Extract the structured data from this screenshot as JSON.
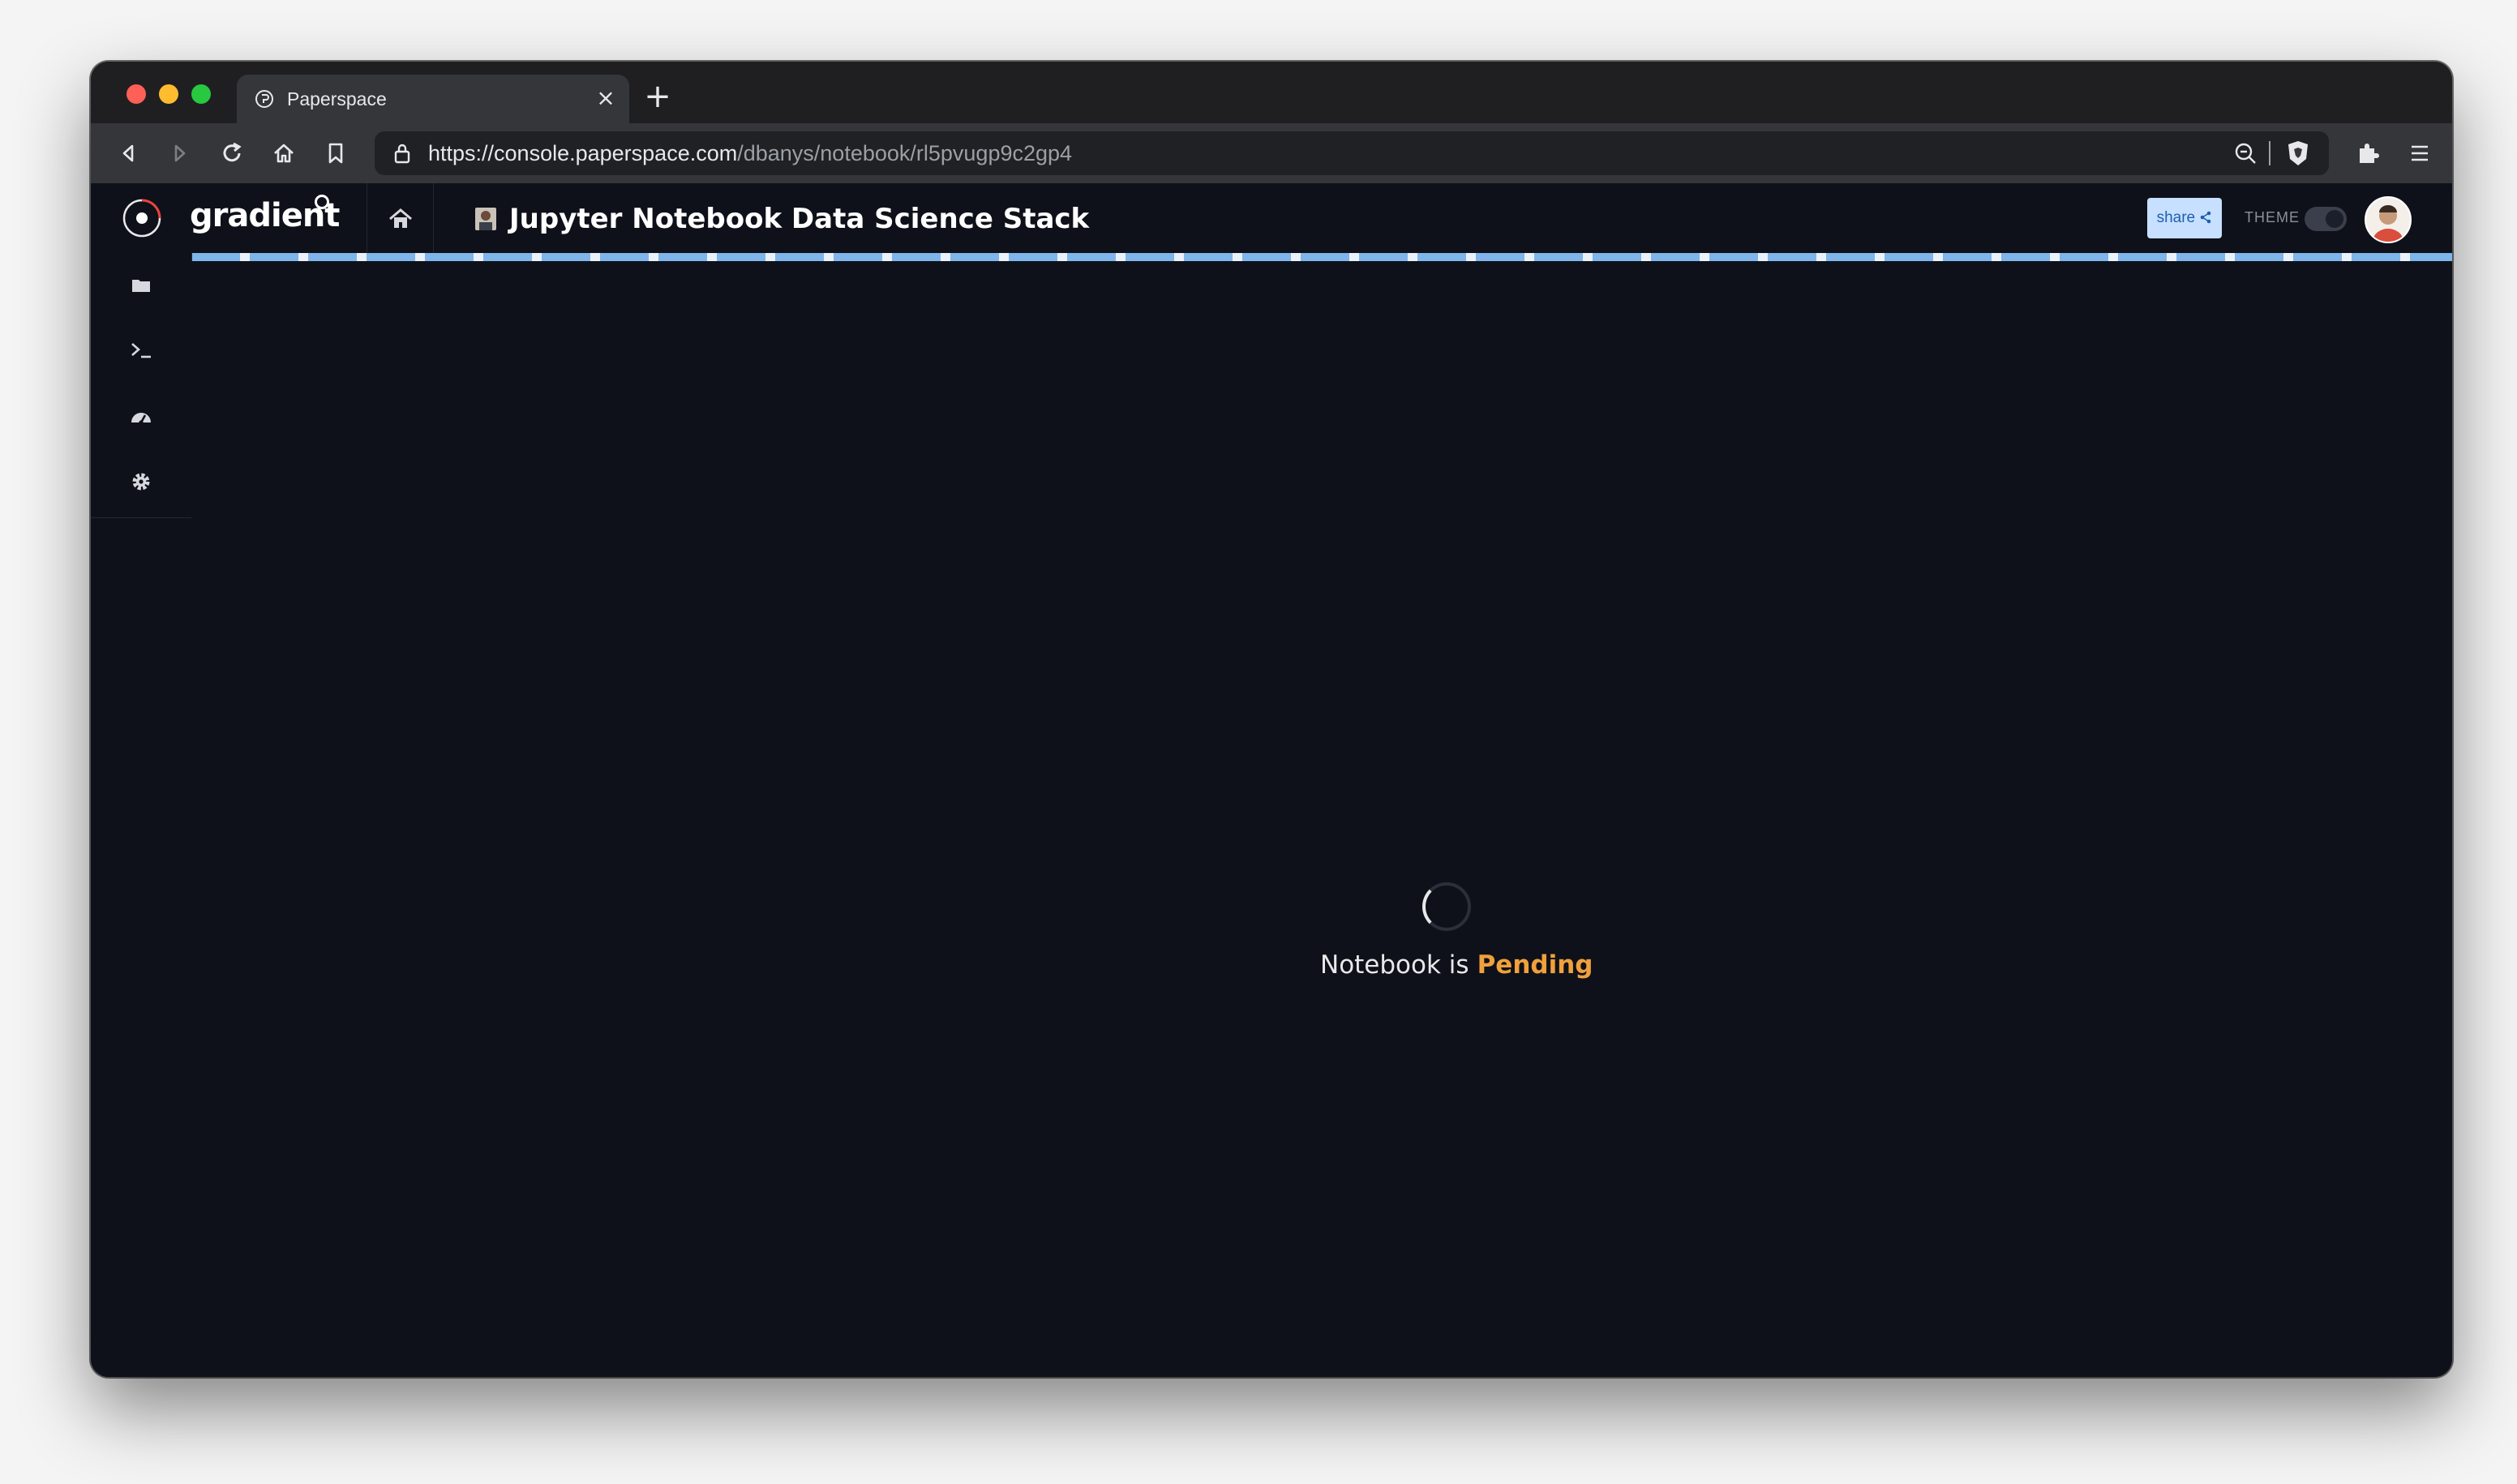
{
  "browser": {
    "tab_title": "Paperspace",
    "url_host": "https://console.paperspace.com",
    "url_path": "/dbanys/notebook/rl5pvugp9c2gp4",
    "icons": [
      "back-icon",
      "forward-icon",
      "reload-icon",
      "home-icon",
      "bookmark-icon",
      "lock-icon",
      "zoom-icon",
      "brave-shield-icon",
      "extensions-icon",
      "menu-icon"
    ]
  },
  "app": {
    "logo_text": "gradient",
    "title": "Jupyter Notebook Data Science Stack",
    "share_label": "share",
    "theme_label": "THEME",
    "theme_dark": true
  },
  "sidebar": {
    "items": [
      {
        "name": "folder-icon"
      },
      {
        "name": "terminal-icon"
      },
      {
        "name": "dashboard-icon"
      },
      {
        "name": "settings-icon"
      }
    ]
  },
  "main": {
    "status_prefix": "Notebook is",
    "status_value": "Pending"
  },
  "colors": {
    "background": "#0e1119",
    "pending": "#f0a03c",
    "share_bg": "#c7e0ff",
    "progress": "#7fb5ea"
  }
}
